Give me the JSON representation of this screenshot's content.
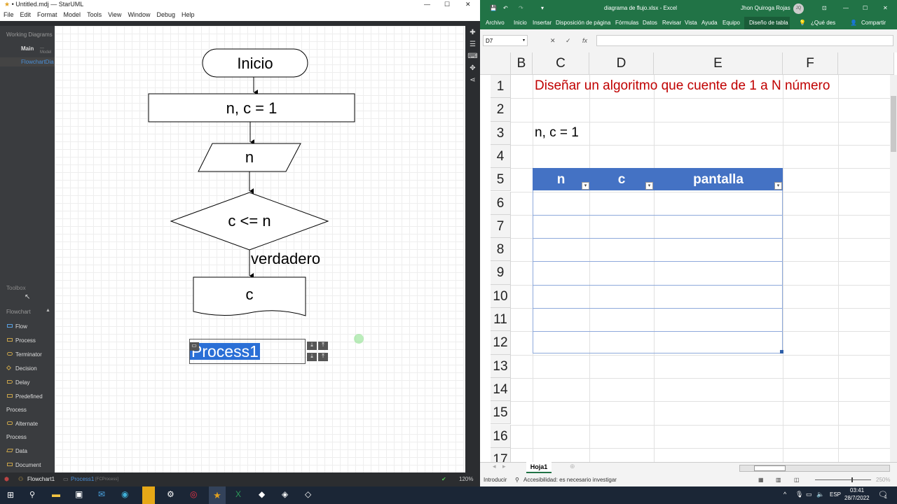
{
  "staruml": {
    "title": "• Untitled.mdj — StarUML",
    "menu": [
      "File",
      "Edit",
      "Format",
      "Model",
      "Tools",
      "View",
      "Window",
      "Debug",
      "Help"
    ],
    "working_diagrams": "Working Diagrams",
    "diagrams": [
      {
        "name": "Main",
        "suffix": "— Model"
      },
      {
        "name": "FlowchartDia"
      }
    ],
    "toolbox": "Toolbox",
    "flowchart_section": "Flowchart",
    "tools": [
      "Flow",
      "Process",
      "Terminator",
      "Decision",
      "Delay",
      "Predefined"
    ],
    "tool_group1": "Process",
    "tools2": [
      "Alternate"
    ],
    "tool_group2": "Process",
    "tools3": [
      "Data",
      "Document"
    ],
    "shapes": {
      "start": "Inicio",
      "init": "n, c = 1",
      "input": "n",
      "decision": "c <= n",
      "branch_label": "verdadero",
      "output": "c",
      "editing": "Process1"
    },
    "status": {
      "diagram": "Flowchart1",
      "selected": "Process1",
      "selected_type": "[FCProcess]",
      "zoom": "120%"
    }
  },
  "excel": {
    "title": "diagrama de flujo.xlsx  -  Excel",
    "user": "Jhon Quiroga Rojas",
    "user_initials": "JQ",
    "tabs": [
      "Archivo",
      "Inicio",
      "Insertar",
      "Disposición de página",
      "Fórmulas",
      "Datos",
      "Revisar",
      "Vista",
      "Ayuda",
      "Equipo",
      "Diseño de tabla",
      "¿Qué des",
      "Compartir"
    ],
    "name_box": "D7",
    "columns": [
      "B",
      "C",
      "D",
      "E",
      "F"
    ],
    "rows": [
      "1",
      "2",
      "3",
      "4",
      "5",
      "6",
      "7",
      "8",
      "9",
      "10",
      "11",
      "12",
      "13",
      "14",
      "15",
      "16",
      "17"
    ],
    "cell_title": "Diseñar un algoritmo que cuente de 1 a N número",
    "cell_c3": "n, c = 1",
    "table_headers": [
      "n",
      "c",
      "pantalla"
    ],
    "sheet_tab": "Hoja1",
    "status_mode": "Introducir",
    "accessibility": "Accesibilidad: es necesario investigar",
    "zoom": "250%",
    "accent": "#217346"
  },
  "taskbar": {
    "language": "ESP",
    "time": "03:41",
    "date": "28/7/2022",
    "notifications": "1"
  }
}
